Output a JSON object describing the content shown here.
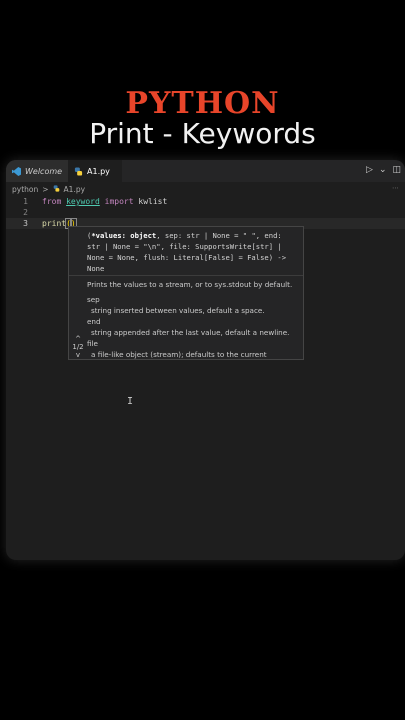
{
  "header": {
    "title": "PYTHON",
    "subtitle": "Print - Keywords",
    "title_color": "#e8452a"
  },
  "tabs": [
    {
      "label": "Welcome",
      "icon": "vscode-icon",
      "active": false
    },
    {
      "label": "A1.py",
      "icon": "python-icon",
      "active": true
    }
  ],
  "toolbar": {
    "run_icon": "play-icon",
    "run_symbol": "▷",
    "dropdown_symbol": "⌄",
    "split_symbol": "◫"
  },
  "breadcrumb": {
    "folder": "python",
    "separator": ">",
    "file": "A1.py"
  },
  "editor": {
    "lines": [
      {
        "number": "1",
        "kw1": "from",
        "module": "keyword",
        "kw2": "import",
        "name": "kwlist"
      },
      {
        "number": "2"
      },
      {
        "number": "3",
        "fn": "print",
        "open": "(",
        "close": ")"
      }
    ]
  },
  "hover": {
    "signature_1": "(",
    "signature_bold": "*values: object",
    "signature_rest": ", sep: str | None = \" \", end: str | None = \"\\n\", file: SupportsWrite[str] | None = None, flush: Literal[False] = False) -> None",
    "summary": "Prints the values to a stream, or to sys.stdout by default.",
    "params": [
      {
        "term": "sep",
        "desc": "string inserted between values, default a space."
      },
      {
        "term": "end",
        "desc": "string appended after the last value, default a newline."
      },
      {
        "term": "file",
        "desc": "a file-like object (stream); defaults to the current"
      }
    ],
    "nav_up": "^",
    "nav_count": "1/2",
    "nav_down": "v"
  },
  "mouse_cursor": "I"
}
